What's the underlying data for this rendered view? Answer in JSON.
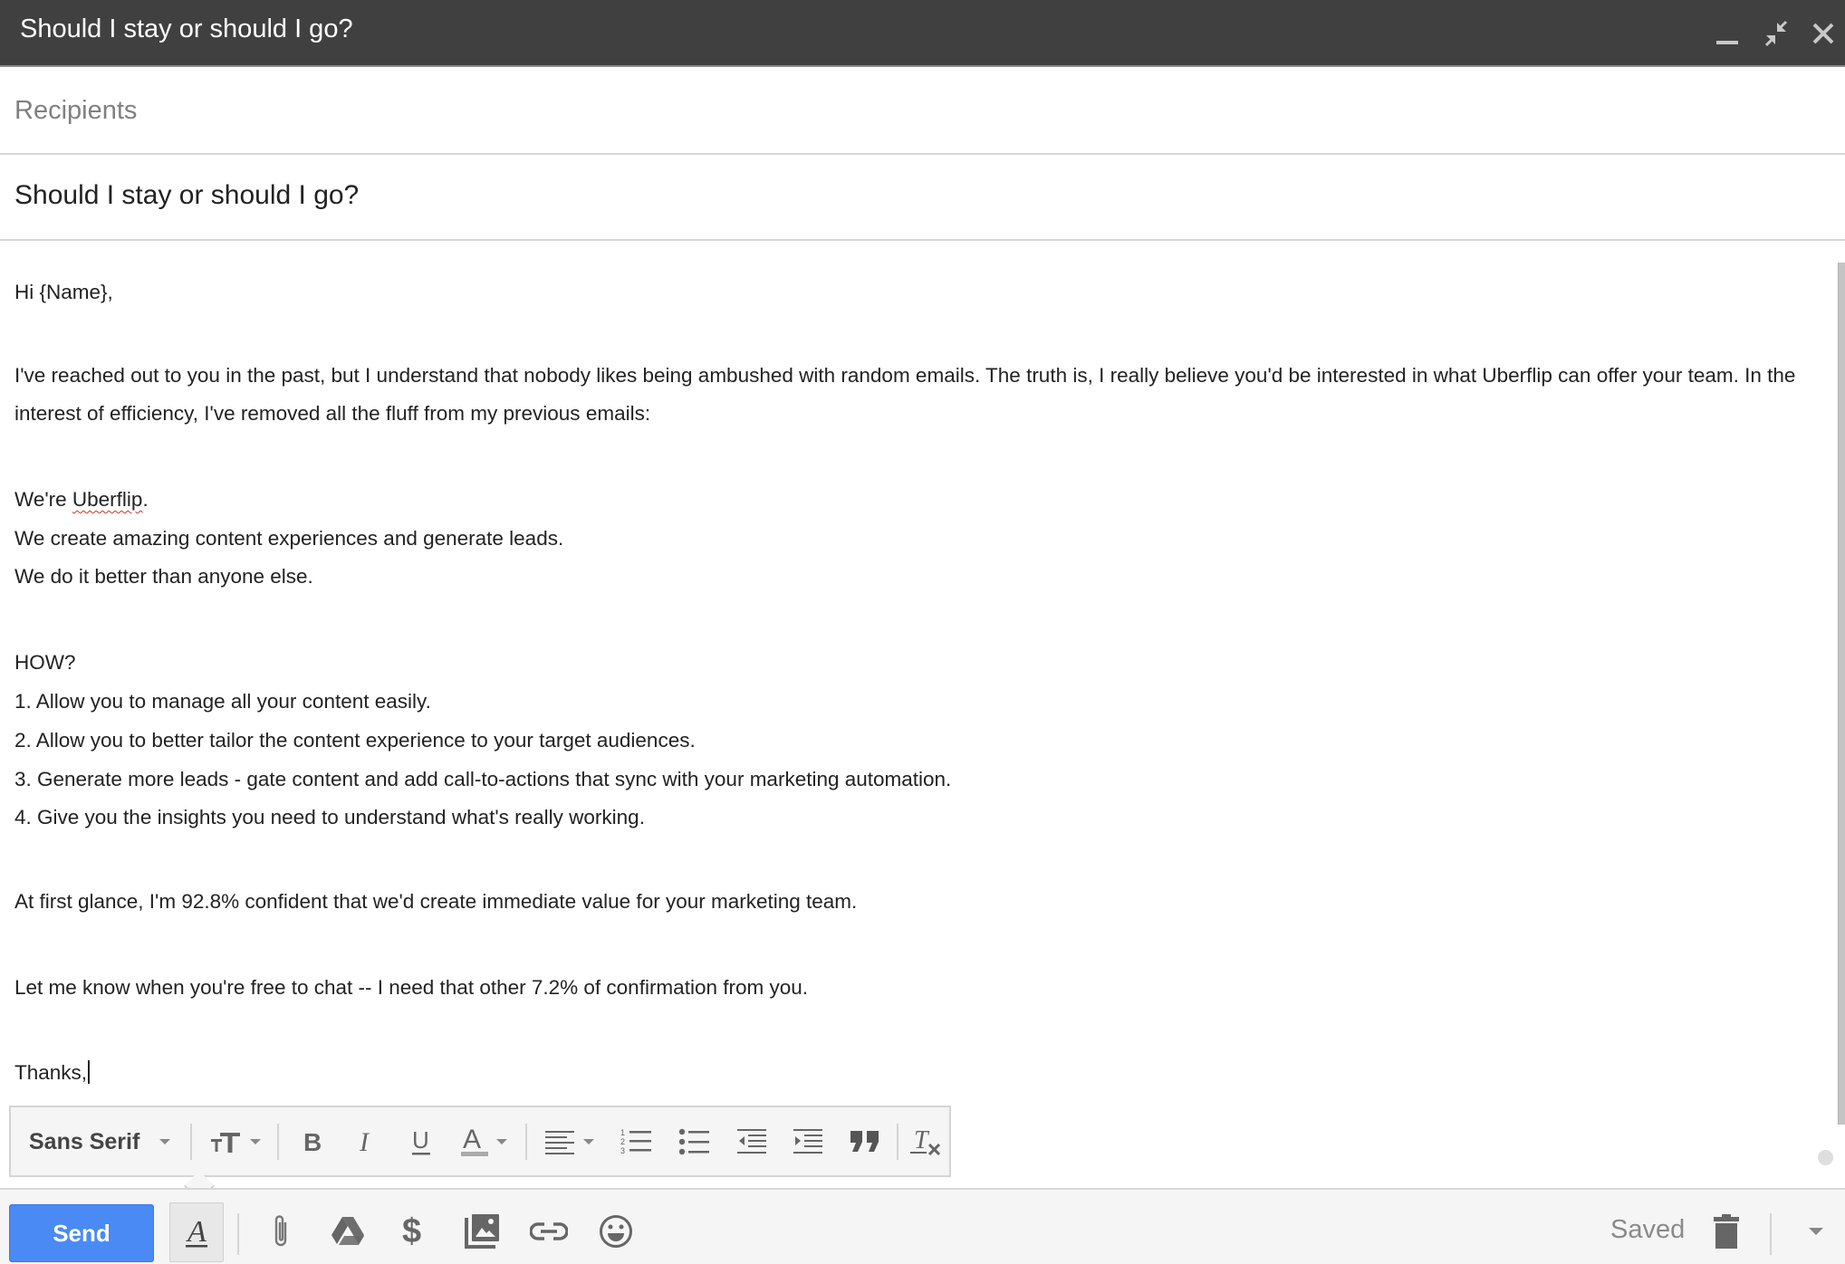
{
  "window": {
    "title": "Should I stay or should I go?",
    "controls": {
      "minimize": "minimize-icon",
      "exit_fullscreen": "exit-fullscreen-icon",
      "close": "close-icon"
    }
  },
  "compose": {
    "recipients_placeholder": "Recipients",
    "subject": "Should I stay or should I go?",
    "body_lines": [
      "Hi {Name},",
      "I've reached out to you in the past, but I understand that nobody likes being ambushed with random emails. The truth is, I really believe you'd be interested in what Uberflip can offer your team. In the",
      "interest of efficiency, I've removed all the fluff from my previous emails:",
      "We're ",
      "We create amazing content experiences and generate leads.",
      "We do it better than anyone else.",
      "HOW?",
      "1. Allow you to manage all your content easily.",
      "2. Allow you to better tailor the content experience to your target audiences.",
      "3. Generate more leads - gate content and add call-to-actions that sync with your marketing automation.",
      "4. Give you the insights you need to understand what's really working.",
      "At first glance, I'm 92.8% confident that we'd create immediate value for your marketing team.",
      "Let me know when you're free to chat -- I need that other 7.2% of confirmation from you.",
      "Thanks,"
    ],
    "misspelled_word": "Uberflip",
    "misspelled_suffix": "."
  },
  "format_toolbar": {
    "font_family": "Sans Serif",
    "items": [
      "font-size-icon",
      "bold-icon",
      "italic-icon",
      "underline-icon",
      "text-color-icon",
      "align-icon",
      "numbered-list-icon",
      "bulleted-list-icon",
      "indent-less-icon",
      "indent-more-icon",
      "quote-icon",
      "remove-formatting-icon"
    ]
  },
  "bottom_toolbar": {
    "send_label": "Send",
    "status": "Saved",
    "icons": [
      "formatting-options-icon",
      "attach-file-icon",
      "google-drive-icon",
      "send-money-icon",
      "insert-photo-icon",
      "insert-link-icon",
      "insert-emoji-icon",
      "discard-draft-icon",
      "more-options-icon"
    ]
  },
  "colors": {
    "title_bar": "#404040",
    "send_button": "#4a8af4",
    "misspelling": "#d93025"
  }
}
